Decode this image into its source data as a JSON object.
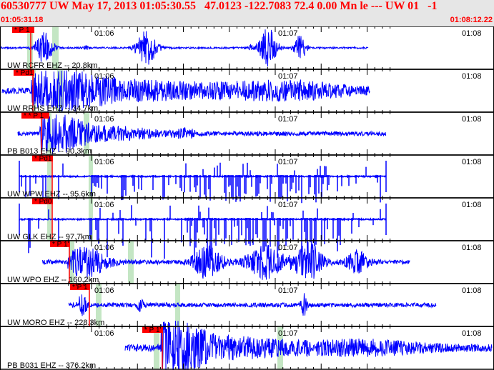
{
  "header": {
    "title": "60530777 UW May 17, 2013 01:05:30.55   47.0123 -122.7083 72.4 0.00 Mn le --- UW 01   -1",
    "start_time": "01:05:31.18",
    "end_time": "01:08:12.22"
  },
  "time_labels": [
    "01:06",
    "01:07",
    "01:08"
  ],
  "colors": {
    "trace": "#0000ff",
    "pick": "#ff0000",
    "window": "#c4e6c4",
    "header_bg": "#e6e6e6",
    "header_text": "#ff0000"
  },
  "traces": [
    {
      "station": "UW RCFR EHZ -- 20.8km",
      "pick": "* P 1"
    },
    {
      "station": "UW RRHS EHZ -- 34.7km",
      "pick": "* Pd1"
    },
    {
      "station": "PB B013 EHZ -- 90.3km",
      "pick": "* * P 1"
    },
    {
      "station": "UW WPW EHZ -- 95.6km",
      "pick": "* Pd1"
    },
    {
      "station": "UW GLK EHZ -- 97.7km",
      "pick": "* Pd0"
    },
    {
      "station": "UW WPO EHZ -- 160.2km",
      "pick": "* P 1"
    },
    {
      "station": "UW MORO EHZ -- 228.3km",
      "pick": "* P 1"
    },
    {
      "station": "PB B031 EHZ -- 376.2km",
      "pick": "* P 1"
    }
  ]
}
